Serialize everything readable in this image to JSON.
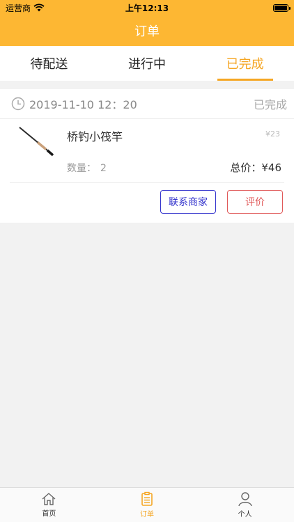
{
  "status_bar": {
    "carrier": "运营商",
    "time": "上午12:13"
  },
  "nav": {
    "title": "订单"
  },
  "tabs": [
    {
      "label": "待配送",
      "active": false
    },
    {
      "label": "进行中",
      "active": false
    },
    {
      "label": "已完成",
      "active": true
    }
  ],
  "order": {
    "datetime": "2019-11-10 12：20",
    "status": "已完成",
    "product": {
      "name": "桥钓小筏竿",
      "unit_price": "¥23",
      "qty_label": "数量：",
      "qty_value": "2",
      "total": "总价：¥46"
    },
    "actions": {
      "contact": "联系商家",
      "review": "评价"
    }
  },
  "tab_bar": [
    {
      "label": "首页",
      "icon": "home-icon",
      "active": false
    },
    {
      "label": "订单",
      "icon": "order-icon",
      "active": true
    },
    {
      "label": "个人",
      "icon": "person-icon",
      "active": false
    }
  ],
  "colors": {
    "accent": "#fdb733",
    "active_text": "#f5a623",
    "contact": "#3333cc",
    "review": "#e05a5a"
  }
}
